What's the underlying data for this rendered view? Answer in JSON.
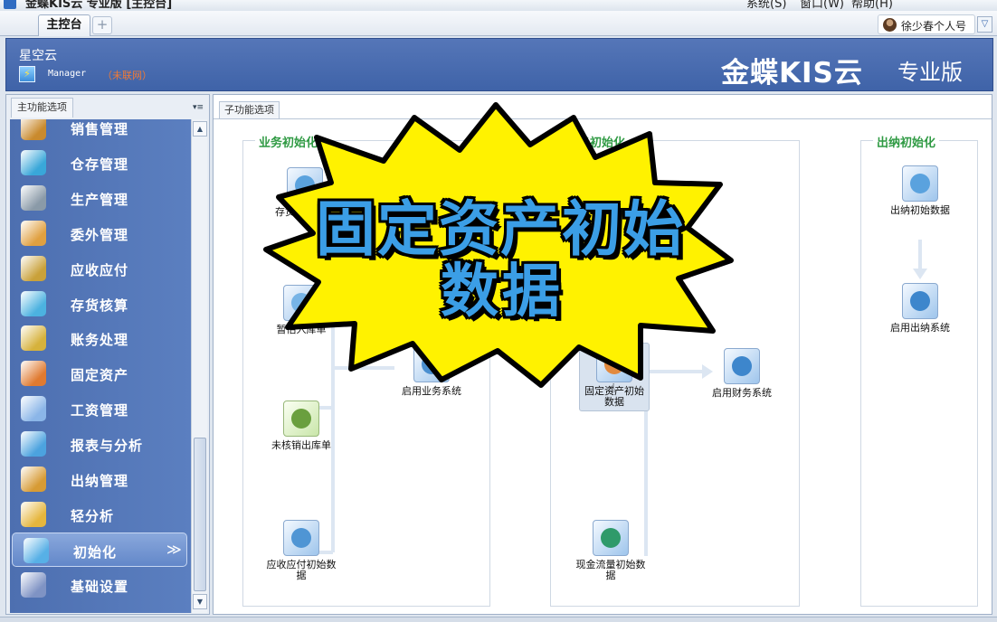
{
  "titlebar": {
    "title": "金蝶KIS云 专业版 [主控台]",
    "menus": [
      "系统(S)",
      "窗口(W)",
      "帮助(H)"
    ]
  },
  "tabs": {
    "main_label": "主控台",
    "add_label": "+",
    "user_name": "徐少春个人号"
  },
  "banner": {
    "cloud_name": "星空云",
    "login_user": "Manager",
    "login_status": "（未联网）",
    "brand": "金蝶KIS云",
    "edition": "专业版"
  },
  "left_panel": {
    "title": "主功能选项",
    "items": [
      {
        "label": "销售管理",
        "icon": "sales-person-icon",
        "color": "#c98a2e"
      },
      {
        "label": "仓存管理",
        "icon": "warehouse-boxes-icon",
        "color": "#39a7d9"
      },
      {
        "label": "生产管理",
        "icon": "production-machine-icon",
        "color": "#8a9aa8"
      },
      {
        "label": "委外管理",
        "icon": "outsource-people-icon",
        "color": "#e0a040"
      },
      {
        "label": "应收应付",
        "icon": "money-bag-icon",
        "color": "#c9a13a"
      },
      {
        "label": "存货核算",
        "icon": "inventory-accounting-icon",
        "color": "#4cb2e0"
      },
      {
        "label": "账务处理",
        "icon": "ledger-icon",
        "color": "#d6b23c"
      },
      {
        "label": "固定资产",
        "icon": "fixed-asset-icon",
        "color": "#e07a30"
      },
      {
        "label": "工资管理",
        "icon": "payroll-icon",
        "color": "#8bb6e8"
      },
      {
        "label": "报表与分析",
        "icon": "report-icon",
        "color": "#4ca3df"
      },
      {
        "label": "出纳管理",
        "icon": "cashier-icon",
        "color": "#d79b35"
      },
      {
        "label": "轻分析",
        "icon": "light-analysis-icon",
        "color": "#e6b63d"
      },
      {
        "label": "初始化",
        "icon": "initialize-icon",
        "color": "#57b0e6",
        "active": true
      },
      {
        "label": "基础设置",
        "icon": "basic-settings-icon",
        "color": "#7f93c4"
      }
    ],
    "expand_glyph": "≫"
  },
  "right_panel": {
    "title": "子功能选项",
    "groups": {
      "business": {
        "title": "业务初始化",
        "items": [
          {
            "label": "存货初始数据",
            "icon": "inventory-init-icon"
          },
          {
            "label": "暂估入库单",
            "icon": "provisional-receipt-icon"
          },
          {
            "label": "未核销出库单",
            "icon": "unverified-outbound-icon"
          },
          {
            "label": "应收应付初始数据",
            "icon": "ar-ap-init-icon"
          },
          {
            "label": "启用业务系统",
            "icon": "enable-business-icon"
          }
        ]
      },
      "finance": {
        "title": "财务初始化",
        "items": [
          {
            "label": "固定资产初始数据",
            "icon": "fixed-asset-init-icon"
          },
          {
            "label": "启用财务系统",
            "icon": "enable-finance-icon"
          },
          {
            "label": "现金流量初始数据",
            "icon": "cash-flow-init-icon"
          }
        ]
      },
      "cashier": {
        "title": "出纳初始化",
        "items": [
          {
            "label": "出纳初始数据",
            "icon": "cashier-init-icon"
          },
          {
            "label": "启用出纳系统",
            "icon": "enable-cashier-icon"
          }
        ]
      }
    }
  },
  "overlay": {
    "line1": "固定资产初始",
    "line2": "数据",
    "burst_color": "#fff200",
    "text_color": "#3b9ee6"
  }
}
